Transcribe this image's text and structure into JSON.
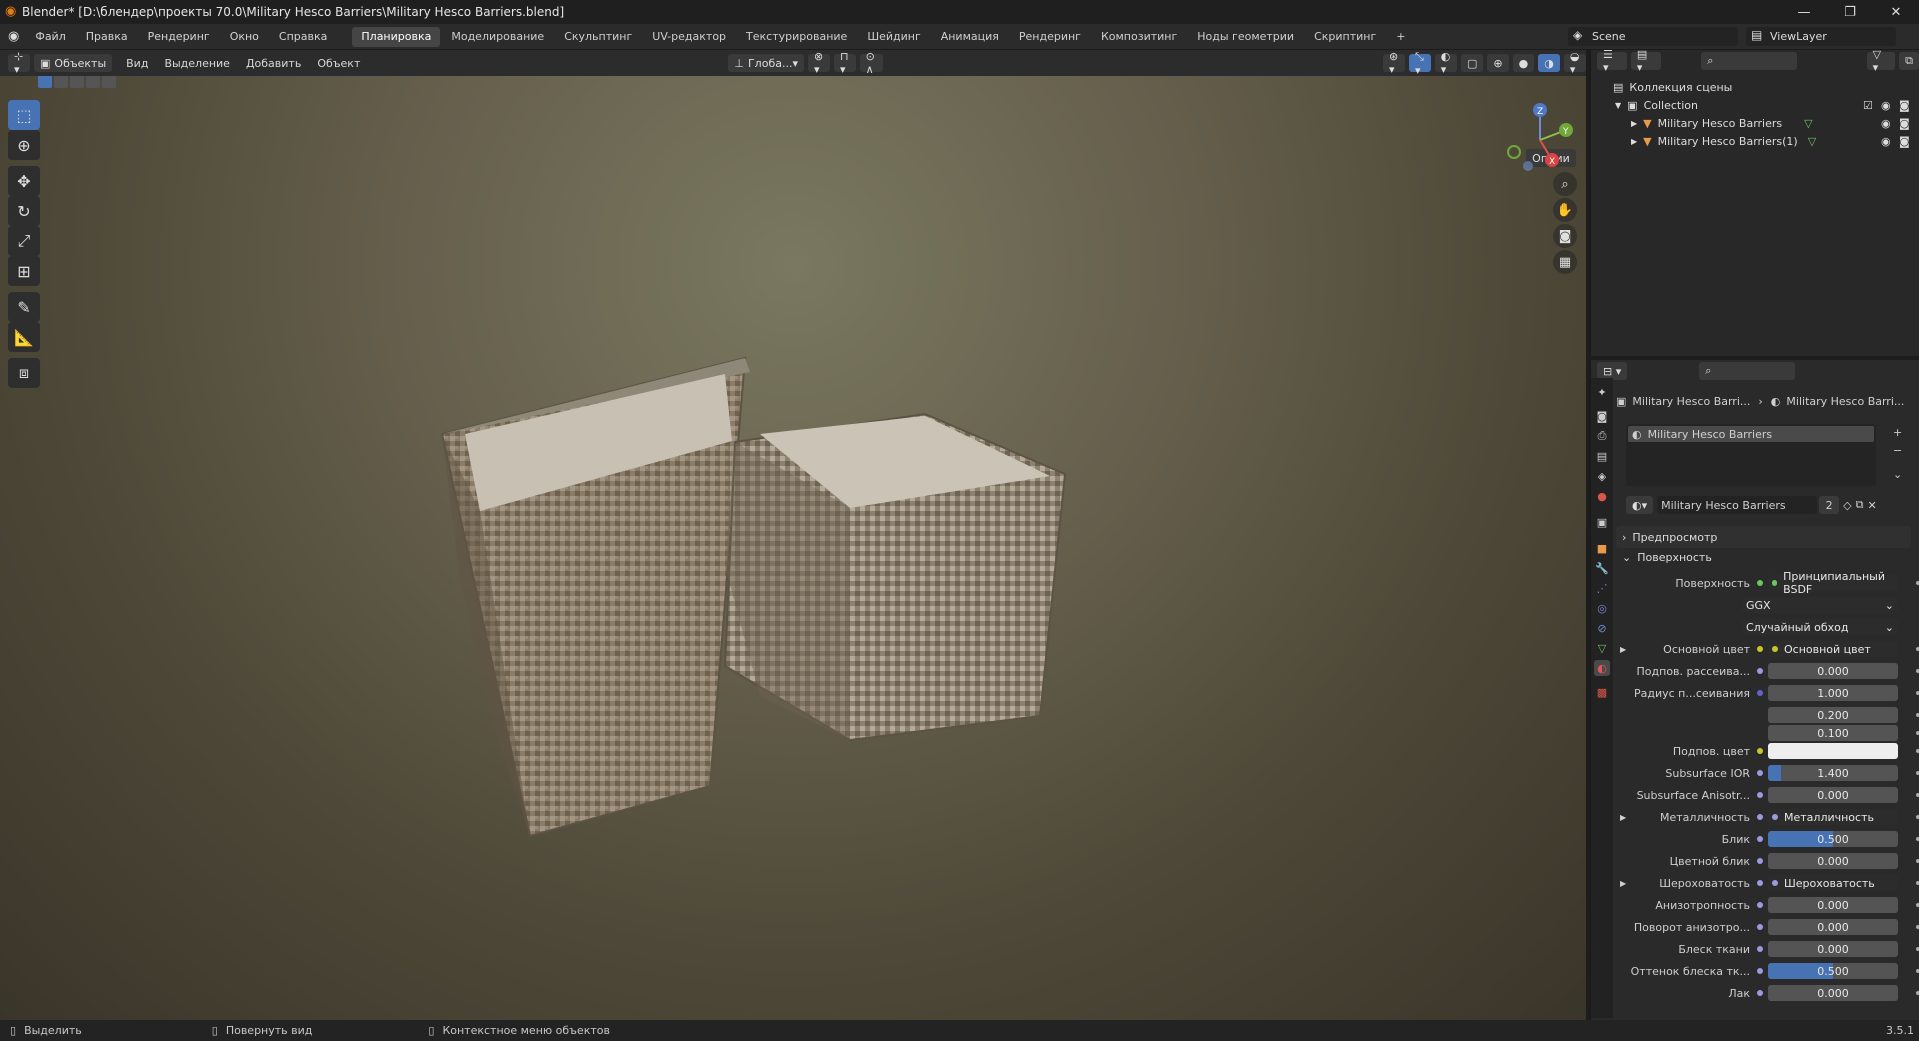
{
  "titlebar": {
    "title": "Blender* [D:\\блендер\\проекты 70.0\\Military Hesco Barriers\\Military Hesco Barriers.blend]",
    "min": "—",
    "max": "❐",
    "close": "✕"
  },
  "menu": [
    "Файл",
    "Правка",
    "Рендеринг",
    "Окно",
    "Справка"
  ],
  "workspaces": [
    "Планировка",
    "Моделирование",
    "Скульптинг",
    "UV-редактор",
    "Текстурирование",
    "Шейдинг",
    "Анимация",
    "Рендеринг",
    "Композитинг",
    "Ноды геометрии",
    "Скриптинг"
  ],
  "workspace_add": "+",
  "scene": {
    "name": "Scene",
    "viewlayer": "ViewLayer"
  },
  "vpheader": {
    "mode": "Объекты",
    "menus": [
      "Вид",
      "Выделение",
      "Добавить",
      "Объект"
    ],
    "transform": "Глоба...",
    "options": "Опции"
  },
  "outliner": {
    "root": "Коллекция сцены",
    "collection": "Collection",
    "objects": [
      "Military Hesco Barriers",
      "Military Hesco Barriers(1)"
    ]
  },
  "props": {
    "crumb1": "Military Hesco Barri...",
    "crumb2": "Military Hesco Barri...",
    "slot": "Military Hesco Barriers",
    "material": "Military Hesco Barriers",
    "users": "2",
    "preview": "Предпросмотр",
    "surface_section": "Поверхность",
    "rows": [
      {
        "label": "Поверхность",
        "value": "Принципиальный BSDF",
        "kind": "node",
        "dot": "#6ac75f"
      },
      {
        "label": "",
        "value": "GGX",
        "kind": "select"
      },
      {
        "label": "",
        "value": "Случайный обход",
        "kind": "select"
      },
      {
        "label": "Основной цвет",
        "value": "Основной цвет",
        "kind": "node",
        "dot": "#c7c729",
        "expand": true
      },
      {
        "label": "Подпов. рассеива...",
        "value": "0.000",
        "kind": "num",
        "dot": "#9a9ae0"
      },
      {
        "label": "Радиус п...сеивания",
        "value": "1.000",
        "kind": "num",
        "dot": "#6363c7"
      },
      {
        "label": "",
        "value": "0.200",
        "kind": "num"
      },
      {
        "label": "",
        "value": "0.100",
        "kind": "num"
      },
      {
        "label": "Подпов. цвет",
        "value": "",
        "kind": "color",
        "dot": "#c7c729"
      },
      {
        "label": "Subsurface IOR",
        "value": "1.400",
        "kind": "num",
        "dot": "#9a9ae0",
        "fill": 0.1
      },
      {
        "label": "Subsurface Anisotr...",
        "value": "0.000",
        "kind": "num",
        "dot": "#9a9ae0"
      },
      {
        "label": "Металличность",
        "value": "Металличность",
        "kind": "node",
        "dot": "#9a9ae0",
        "expand": true
      },
      {
        "label": "Блик",
        "value": "0.500",
        "kind": "num",
        "dot": "#9a9ae0",
        "fill": 0.5
      },
      {
        "label": "Цветной блик",
        "value": "0.000",
        "kind": "num",
        "dot": "#9a9ae0"
      },
      {
        "label": "Шероховатость",
        "value": "Шероховатость",
        "kind": "node",
        "dot": "#9a9ae0",
        "expand": true
      },
      {
        "label": "Анизотропность",
        "value": "0.000",
        "kind": "num",
        "dot": "#9a9ae0"
      },
      {
        "label": "Поворот анизотро...",
        "value": "0.000",
        "kind": "num",
        "dot": "#9a9ae0"
      },
      {
        "label": "Блеск ткани",
        "value": "0.000",
        "kind": "num",
        "dot": "#9a9ae0"
      },
      {
        "label": "Оттенок блеска тк...",
        "value": "0.500",
        "kind": "num",
        "dot": "#9a9ae0",
        "fill": 0.5
      },
      {
        "label": "Лак",
        "value": "0.000",
        "kind": "num",
        "dot": "#9a9ae0"
      }
    ]
  },
  "status": {
    "select": "Выделить",
    "rotate": "Повернуть вид",
    "context": "Контекстное меню объектов",
    "version": "3.5.1"
  },
  "colors": {
    "accent": "#4772b3",
    "bg": "#2a2a2a"
  }
}
